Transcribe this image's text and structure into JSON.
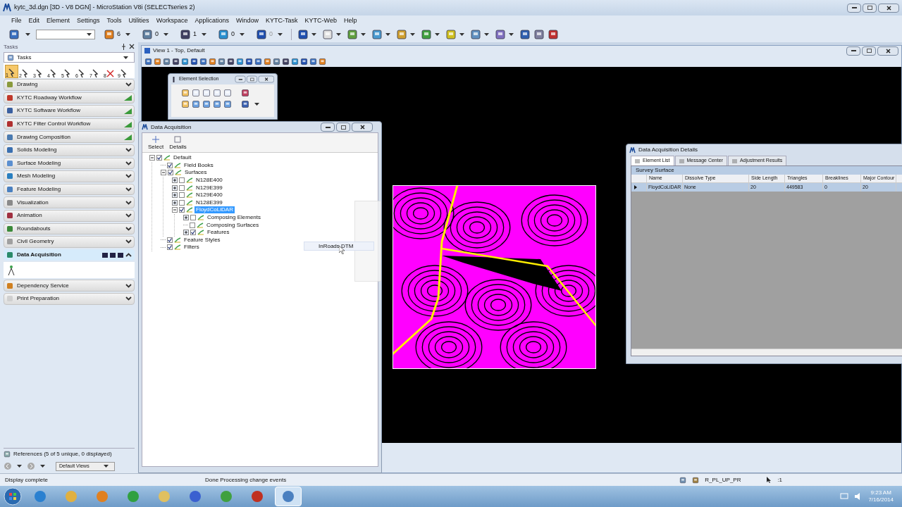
{
  "window": {
    "title": "kytc_3d.dgn [3D - V8 DGN] - MicroStation V8i (SELECTseries 2)"
  },
  "menu": [
    "File",
    "Edit",
    "Element",
    "Settings",
    "Tools",
    "Utilities",
    "Workspace",
    "Applications",
    "Window",
    "KYTC-Task",
    "KYTC-Web",
    "Help"
  ],
  "toolbar": {
    "counts": [
      "6",
      "0",
      "1",
      "0",
      "0"
    ]
  },
  "tasks": {
    "title": "Tasks",
    "dropdown": "Tasks",
    "tool_numbers": [
      "1",
      "2",
      "3",
      "4",
      "5",
      "6",
      "7",
      "8",
      "9"
    ],
    "items": [
      {
        "label": "Drawing",
        "expanded": false,
        "kind": "chevron"
      },
      {
        "label": "KYTC Roadway Workflow",
        "expanded": false,
        "kind": "workflow"
      },
      {
        "label": "KYTC Software Workflow",
        "expanded": false,
        "kind": "workflow"
      },
      {
        "label": "KYTC Filter Control Workflow",
        "expanded": false,
        "kind": "workflow"
      },
      {
        "label": "Drawing Composition",
        "expanded": false,
        "kind": "workflow"
      },
      {
        "label": "Solids Modeling",
        "expanded": false,
        "kind": "chevron"
      },
      {
        "label": "Surface Modeling",
        "expanded": false,
        "kind": "chevron"
      },
      {
        "label": "Mesh Modeling",
        "expanded": false,
        "kind": "chevron"
      },
      {
        "label": "Feature Modeling",
        "expanded": false,
        "kind": "chevron"
      },
      {
        "label": "Visualization",
        "expanded": false,
        "kind": "chevron"
      },
      {
        "label": "Animation",
        "expanded": false,
        "kind": "chevron"
      },
      {
        "label": "Roundabouts",
        "expanded": false,
        "kind": "chevron"
      },
      {
        "label": "Civil Geometry",
        "expanded": false,
        "kind": "chevron"
      },
      {
        "label": "Data Acquisition",
        "expanded": true,
        "kind": "chevron"
      },
      {
        "label": "Dependency Service",
        "expanded": false,
        "kind": "chevron"
      },
      {
        "label": "Print Preparation",
        "expanded": false,
        "kind": "chevron"
      }
    ]
  },
  "references": {
    "label": "References (5 of 5 unique, 0 displayed)",
    "views": "Default Views"
  },
  "view": {
    "title": "View 1 - Top, Default"
  },
  "element_selection": {
    "title": "Element Selection"
  },
  "data_acquisition": {
    "title": "Data Acquisition",
    "tools": [
      "Select",
      "Details"
    ],
    "tree": [
      {
        "label": "Default",
        "checked": true,
        "kind": "folder",
        "expanded": true,
        "selected": false,
        "children": [
          {
            "label": "Field Books",
            "checked": true,
            "kind": "leaf",
            "selected": false
          },
          {
            "label": "Surfaces",
            "checked": true,
            "kind": "folder",
            "expanded": true,
            "selected": false,
            "children": [
              {
                "label": "N128E400",
                "checked": false,
                "kind": "folder",
                "expanded": false,
                "selected": false
              },
              {
                "label": "N129E399",
                "checked": false,
                "kind": "folder",
                "expanded": false,
                "selected": false
              },
              {
                "label": "N129E400",
                "checked": false,
                "kind": "folder",
                "expanded": false,
                "selected": false
              },
              {
                "label": "N128E399",
                "checked": false,
                "kind": "folder",
                "expanded": false,
                "selected": false
              },
              {
                "label": "FloydCoLiDAR",
                "checked": true,
                "kind": "folder",
                "expanded": true,
                "selected": true,
                "children": [
                  {
                    "label": "Composing Elements",
                    "checked": false,
                    "kind": "folder",
                    "expanded": false,
                    "selected": false
                  },
                  {
                    "label": "Composing Surfaces",
                    "checked": false,
                    "kind": "leaf",
                    "selected": false
                  },
                  {
                    "label": "Features",
                    "checked": true,
                    "kind": "folder",
                    "expanded": false,
                    "selected": false
                  }
                ]
              }
            ]
          },
          {
            "label": "Feature Styles",
            "checked": true,
            "kind": "leaf",
            "selected": false
          },
          {
            "label": "Filters",
            "checked": true,
            "kind": "leaf",
            "selected": false
          }
        ]
      }
    ],
    "drag_label": "InRoads DTM"
  },
  "details": {
    "title": "Data Acquisition Details",
    "tabs": [
      {
        "label": "Element List",
        "selected": true
      },
      {
        "label": "Message Center",
        "selected": false
      },
      {
        "label": "Adjustment Results",
        "selected": false
      }
    ],
    "section": "Survey Surface",
    "columns": [
      "Name",
      "Dissolve Type",
      "Side Length",
      "Triangles",
      "Breaklines",
      "Major Contour"
    ],
    "rows": [
      {
        "cells": [
          "FloydCoLiDAR",
          "None",
          "20",
          "449583",
          "0",
          "20"
        ],
        "selected": true
      }
    ]
  },
  "status_bar": {
    "message": "Display complete",
    "prompt": "Done Processing change events",
    "level": "R_PL_UP_PR",
    "count": ":1"
  },
  "taskbar": {
    "time": "9:23 AM",
    "date": "7/16/2014"
  }
}
